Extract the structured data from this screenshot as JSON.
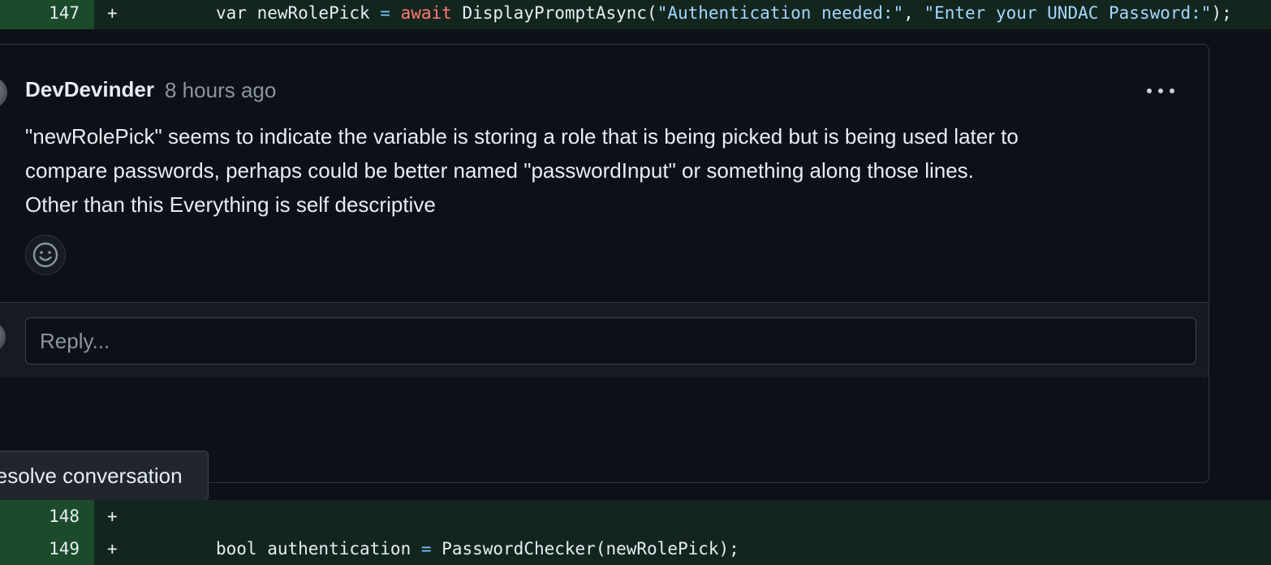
{
  "diff": {
    "line_147": {
      "number": "147",
      "marker": "+",
      "tokens": {
        "t1": "var newRolePick ",
        "t2": "=",
        "t3": " ",
        "t4": "await",
        "t5": " DisplayPromptAsync(",
        "t6": "\"Authentication needed:\"",
        "t7": ", ",
        "t8": "\"Enter your UNDAC Password:\"",
        "t9": ");"
      }
    },
    "line_148": {
      "number": "148",
      "marker": "+"
    },
    "line_149": {
      "number": "149",
      "marker": "+",
      "tokens": {
        "t1": "bool authentication ",
        "t2": "=",
        "t3": " PasswordChecker(newRolePick);"
      }
    }
  },
  "comment": {
    "author": "DevDevinder",
    "time": "8 hours ago",
    "body": {
      "line1": "\"newRolePick\" seems to indicate the variable is storing a role that is being picked but is being used later to",
      "line2": "compare passwords, perhaps could be better named \"passwordInput\" or something along those lines.",
      "line3": "Other than this Everything is self descriptive"
    }
  },
  "reply": {
    "placeholder": "Reply..."
  },
  "actions": {
    "resolve_label": "Resolve conversation"
  },
  "icons": {
    "menu": "kebab-horizontal-icon",
    "reaction": "smiley-icon"
  },
  "colors": {
    "background": "#0d1117",
    "added_line_number_bg": "#1b4b2a",
    "added_line_bg": "#12261e",
    "border": "#30363d",
    "keyword": "#ff7b72",
    "string": "#a5d6ff",
    "operator": "#79c0ff",
    "muted_text": "#8b949e"
  }
}
